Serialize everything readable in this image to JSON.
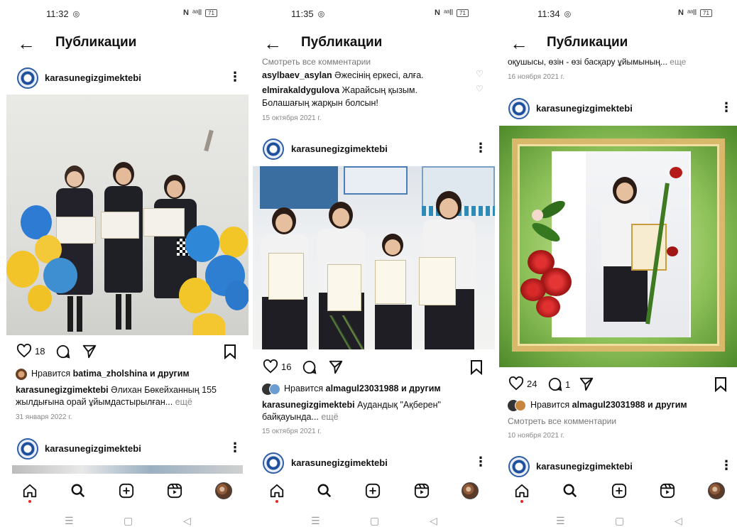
{
  "screens": [
    {
      "status": {
        "time": "11:32"
      },
      "header": {
        "title": "Публикации"
      },
      "post": {
        "username": "karasunegizgimektebi",
        "likes_count": "18",
        "liked_by_prefix": "Нравится ",
        "liked_by_user": "batima_zholshina",
        "liked_by_suffix": " и другим",
        "caption_user": "karasunegizgimektebi",
        "caption_text_1": " Әлихан Бөкейханның 155",
        "caption_text_2": "жылдығына орай ұйымдастырылған...",
        "more": " ещё",
        "date": "31 января 2022 г."
      },
      "next_post": {
        "username": "karasunegizgimektebi"
      }
    },
    {
      "status": {
        "time": "11:35"
      },
      "header": {
        "title": "Публикации"
      },
      "top": {
        "view_all_comments": "Смотреть все комментарии",
        "comment1_user": "asylbaev_asylan",
        "comment1_text": " Әжесінің еркесі, алға.",
        "comment2_user": "elmirakaldygulova",
        "comment2_text_1": " Жарайсың қызым.",
        "comment2_text_2": "Болашағың жарқын болсын!",
        "date": "15 октября 2021 г."
      },
      "post": {
        "username": "karasunegizgimektebi",
        "likes_count": "16",
        "liked_by_prefix": "Нравится ",
        "liked_by_user": "almagul23031988",
        "liked_by_suffix": " и другим",
        "caption_user": "karasunegizgimektebi",
        "caption_text_1": " Аудандық \"Ақберен\"",
        "caption_text_2": "байқауында...",
        "more": " ещё",
        "date": "15 октября 2021 г."
      },
      "next_post": {
        "username": "karasunegizgimektebi"
      }
    },
    {
      "status": {
        "time": "11:34"
      },
      "header": {
        "title": "Публикации"
      },
      "top": {
        "caption_tail": "оқушысы, өзін - өзі басқару ұйымының...",
        "more": " еще",
        "date": "16 ноября 2021 г."
      },
      "post": {
        "username": "karasunegizgimektebi",
        "likes_count": "24",
        "comments_count": "1",
        "liked_by_prefix": "Нравится ",
        "liked_by_user": "almagul23031988",
        "liked_by_suffix": " и другим",
        "view_all_comments": "Смотреть все комментарии",
        "date": "10 ноября 2021 г."
      },
      "next_post": {
        "username": "karasunegizgimektebi"
      }
    }
  ],
  "status_icons": {
    "nfc": "N",
    "signal": "ᵃᵃll",
    "battery": "71"
  },
  "icons": {
    "back": "arrow-left-icon",
    "more": "more-vertical-icon",
    "like": "heart-icon",
    "comment": "comment-icon",
    "share": "send-icon",
    "save": "bookmark-icon",
    "nav": [
      "home-icon",
      "search-icon",
      "add-post-icon",
      "reels-icon",
      "profile-icon"
    ],
    "system": [
      "menu-icon",
      "home-square-icon",
      "back-triangle-icon"
    ]
  },
  "colors": {
    "text": "#111111",
    "secondary": "#888888",
    "accent_blue": "#2f5ea8",
    "notification_dot": "#ee2222"
  }
}
